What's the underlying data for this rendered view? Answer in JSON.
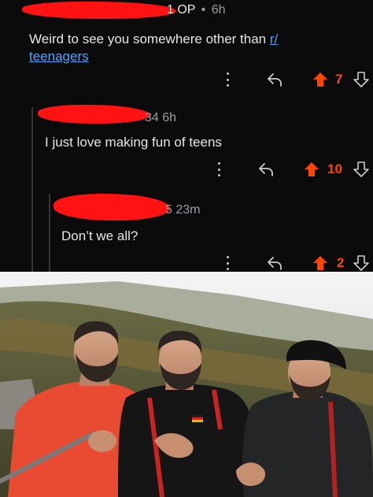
{
  "comments": [
    {
      "op_badge": "1 OP",
      "separator": "•",
      "age": "6h",
      "body_prefix": "Weird to see you somewhere other than ",
      "link_text_1": "r/",
      "link_text_2": "teenagers",
      "score": "7"
    },
    {
      "meta_suffix": "34 6h",
      "body": "I just love making fun of teens",
      "score": "10"
    },
    {
      "meta_suffix": "5 23m",
      "body": "Don’t we all?",
      "score": "2"
    }
  ],
  "icons": {
    "more": "more-options-icon",
    "reply": "reply-icon",
    "upvote": "upvote-icon",
    "downvote": "downvote-icon"
  },
  "colors": {
    "background": "#0b0b0b",
    "upvote": "#ff4500",
    "link": "#4fa3f7",
    "redaction": "#ff1212",
    "thread_line": "#343536"
  }
}
